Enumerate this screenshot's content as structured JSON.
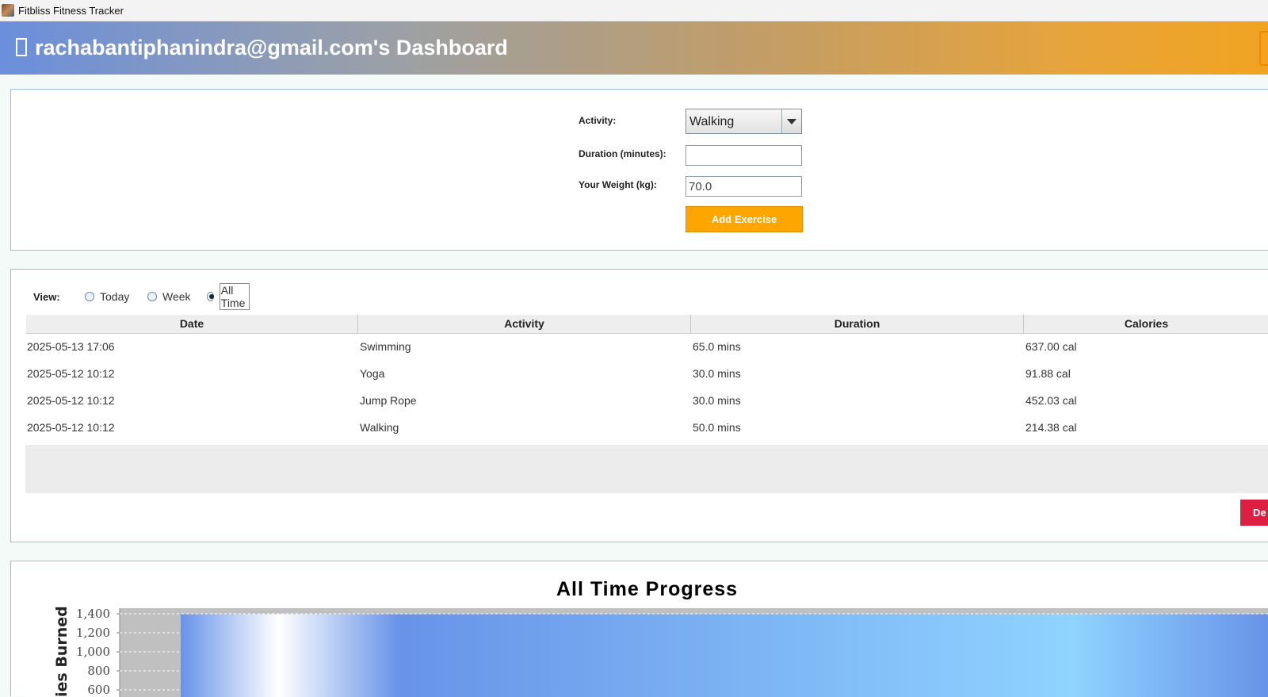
{
  "window": {
    "title": "Fitbliss Fitness Tracker"
  },
  "header": {
    "title": "rachabantiphanindra@gmail.com's Dashboard"
  },
  "form": {
    "activity_label": "Activity:",
    "activity_value": "Walking",
    "duration_label": "Duration (minutes):",
    "duration_value": "",
    "weight_label": "Your Weight (kg):",
    "weight_value": "70.0",
    "add_button": "Add Exercise"
  },
  "view": {
    "label": "View:",
    "options": [
      {
        "label": "Today",
        "selected": false
      },
      {
        "label": "Week",
        "selected": false
      },
      {
        "label": "All Time",
        "selected": true
      }
    ]
  },
  "table": {
    "columns": [
      "Date",
      "Activity",
      "Duration",
      "Calories"
    ],
    "rows": [
      [
        "2025-05-13 17:06",
        "Swimming",
        "65.0 mins",
        "637.00 cal"
      ],
      [
        "2025-05-12 10:12",
        "Yoga",
        "30.0 mins",
        "91.88 cal"
      ],
      [
        "2025-05-12 10:12",
        "Jump Rope",
        "30.0 mins",
        "452.03 cal"
      ],
      [
        "2025-05-12 10:12",
        "Walking",
        "50.0 mins",
        "214.38 cal"
      ]
    ],
    "delete_button_visible": "De"
  },
  "chart_data": {
    "type": "bar",
    "title": "All Time Progress",
    "ylabel": "Calories Burned",
    "ylabel_visible": "ies Burned",
    "yticks": [
      600,
      800,
      1000,
      1200,
      1400
    ],
    "ytick_labels": [
      "600",
      "800",
      "1,000",
      "1,200",
      "1,400"
    ],
    "ylim": [
      0,
      1400
    ],
    "categories": [],
    "values": [
      1395.29
    ],
    "grid": true,
    "colors": {
      "bar_dark": "#6893e8",
      "bar_light": "#8fd3ff",
      "plot_bg": "#c0c0c0"
    }
  }
}
